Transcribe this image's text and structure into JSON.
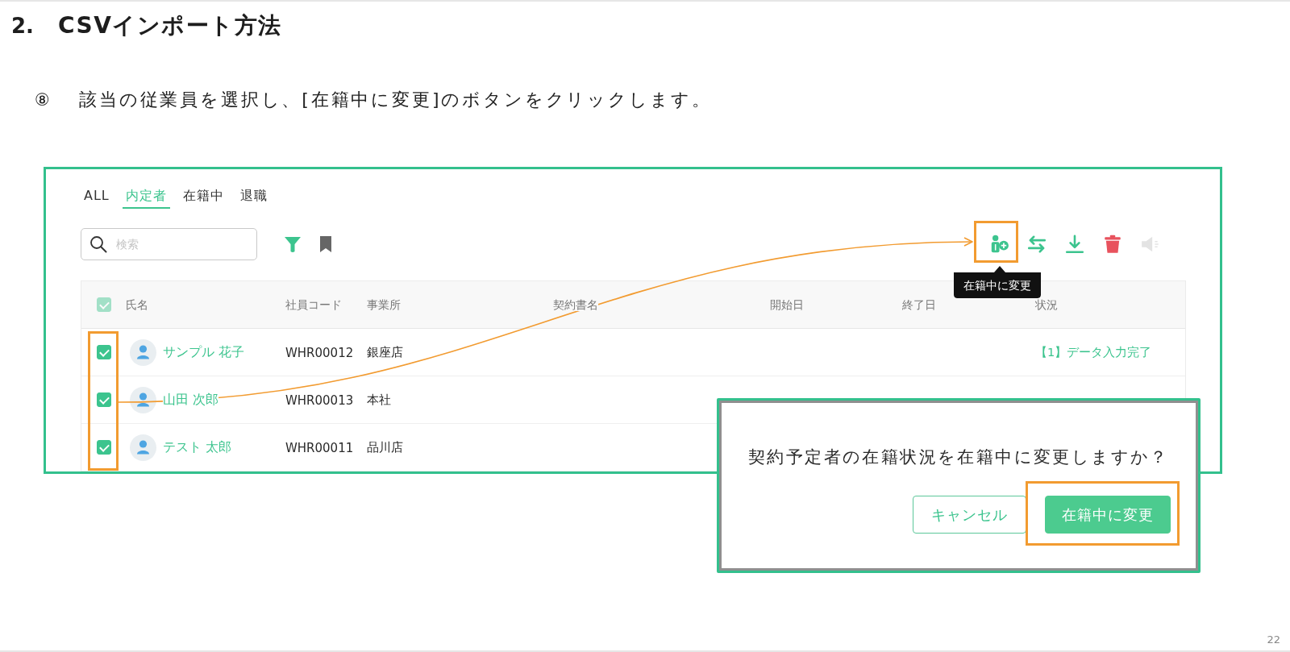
{
  "heading": {
    "number": "2.",
    "title": "CSVインポート方法"
  },
  "step": {
    "number": "⑧",
    "text": "該当の従業員を選択し、[在籍中に変更]のボタンをクリックします。"
  },
  "app": {
    "tabs": [
      {
        "label": "ALL",
        "selected": false
      },
      {
        "label": "内定者",
        "selected": true
      },
      {
        "label": "在籍中",
        "selected": false
      },
      {
        "label": "退職",
        "selected": false
      }
    ],
    "search": {
      "placeholder": "検索"
    },
    "actions": [
      {
        "kind": "enroll",
        "disabled": false
      },
      {
        "kind": "transfer",
        "disabled": false
      },
      {
        "kind": "download",
        "disabled": false
      },
      {
        "kind": "delete",
        "disabled": false
      },
      {
        "kind": "announce",
        "disabled": true
      }
    ],
    "tooltip": "在籍中に変更",
    "table": {
      "select_all": {
        "checked": true,
        "disabled": true
      },
      "columns": [
        "氏名",
        "社員コード",
        "事業所",
        "契約書名",
        "開始日",
        "終了日",
        "状況"
      ],
      "rows": [
        {
          "checked": true,
          "name": "サンプル 花子",
          "code": "WHR00012",
          "office": "銀座店",
          "status": "【1】データ入力完了"
        },
        {
          "checked": true,
          "name": "山田 次郎",
          "code": "WHR00013",
          "office": "本社"
        },
        {
          "checked": true,
          "name": "テスト 太郎",
          "code": "WHR00011",
          "office": "品川店"
        }
      ]
    }
  },
  "dialog": {
    "message": "契約予定者の在籍状況を在籍中に変更しますか？",
    "buttons": [
      {
        "label": "キャンセル",
        "kind": "secondary"
      },
      {
        "label": "在籍中に変更",
        "kind": "primary"
      }
    ]
  },
  "page_number": "22"
}
